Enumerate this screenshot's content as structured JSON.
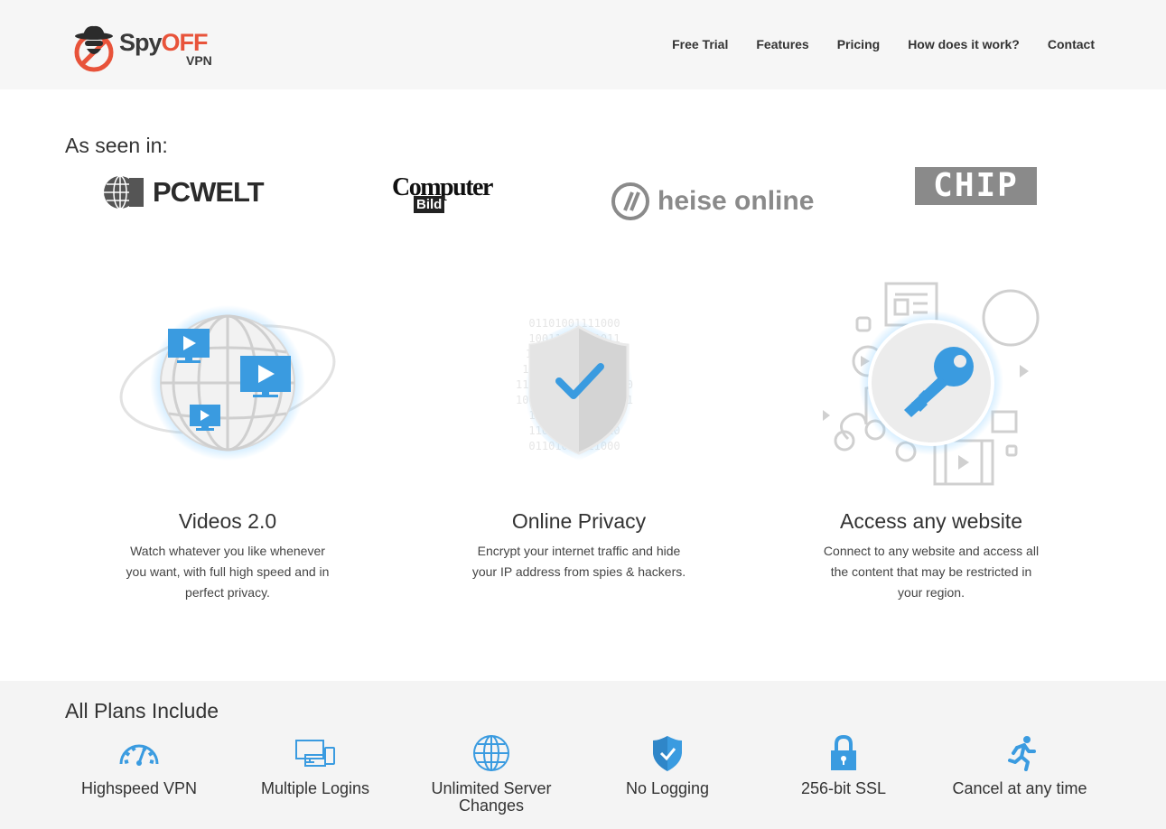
{
  "header": {
    "logo": {
      "spy": "Spy",
      "off": "OFF",
      "vpn": "VPN"
    },
    "nav": [
      "Free Trial",
      "Features",
      "Pricing",
      "How does it work?",
      "Contact"
    ]
  },
  "press": {
    "title": "As seen in:",
    "logos": {
      "pcwelt": "PCWELT",
      "computer": "Computer",
      "bild": "Bild",
      "heise": "heise online",
      "chip": "CHIP"
    }
  },
  "features": [
    {
      "title": "Videos 2.0",
      "text": "Watch whatever you like whenever you want, with full high speed and in perfect privacy."
    },
    {
      "title": "Online Privacy",
      "text": "Encrypt your internet traffic and hide your IP address from spies & hackers."
    },
    {
      "title": "Access any website",
      "text": "Connect to any website and access all the content that may be restricted in your region."
    }
  ],
  "binary_lines": [
    "01101001111000",
    "10011000101011",
    "111101001000001",
    "110 1001 0110000",
    "11111111 100 11000",
    "100100001001000111",
    "11100011010110",
    "11000110011110",
    "01101001111000"
  ],
  "plans": {
    "title": "All Plans Include",
    "items": [
      {
        "label": "Highspeed VPN",
        "icon": "speedometer-icon"
      },
      {
        "label": "Multiple Logins",
        "icon": "devices-icon"
      },
      {
        "label": "Unlimited Server Changes",
        "icon": "globe-icon"
      },
      {
        "label": "No Logging",
        "icon": "shield-check-icon"
      },
      {
        "label": "256-bit SSL",
        "icon": "lock-icon"
      },
      {
        "label": "Cancel at any time",
        "icon": "runner-icon"
      }
    ]
  },
  "colors": {
    "accent_blue": "#3a9be0",
    "logo_red": "#e8533a",
    "header_bg": "#f6f6f6",
    "plans_bg": "#f4f4f4"
  }
}
